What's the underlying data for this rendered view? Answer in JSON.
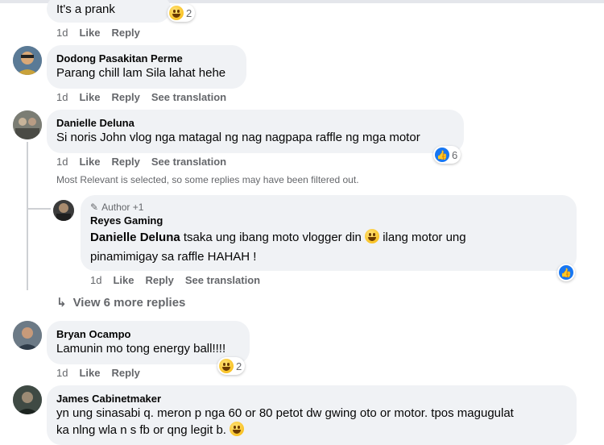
{
  "comments": [
    {
      "text": "It's a prank",
      "time": "1d",
      "like": "Like",
      "reply": "Reply",
      "reaction_count": "2"
    },
    {
      "name": "Dodong Pasakitan Perme",
      "text": "Parang chill lam Sila lahat hehe",
      "time": "1d",
      "like": "Like",
      "reply": "Reply",
      "see_translation": "See translation"
    },
    {
      "name": "Danielle Deluna",
      "text": "Si noris John vlog nga matagal ng nag nagpapa raffle ng mga motor",
      "time": "1d",
      "like": "Like",
      "reply": "Reply",
      "see_translation": "See translation",
      "reaction_count": "6"
    },
    {
      "name": "Bryan Ocampo",
      "text": "Lamunin mo tong energy ball!!!!",
      "time": "1d",
      "like": "Like",
      "reply": "Reply",
      "reaction_count": "2"
    },
    {
      "name": "James Cabinetmaker",
      "text_line1": "yn ung sinasabi q. meron p nga 60 or 80 petot dw gwing oto or motor. tpos magugulat",
      "text_line2": "ka nlng wla n s fb or qng legit b."
    }
  ],
  "filter_note": "Most Relevant is selected, so some replies may have been filtered out.",
  "reply": {
    "author_badge": "Author +1",
    "name": "Reyes Gaming",
    "mention": "Danielle Deluna",
    "text_part1": " tsaka ung ibang moto vlogger din ",
    "text_part2": " ilang motor ung",
    "text_line2": "pinamimigay sa raffle HAHAH !",
    "time": "1d",
    "like": "Like",
    "reply": "Reply",
    "see_translation": "See translation"
  },
  "view_more": "View 6 more replies",
  "colors": {
    "bubble": "#f0f2f5",
    "meta": "#65676b",
    "like_blue": "#1877f2"
  }
}
